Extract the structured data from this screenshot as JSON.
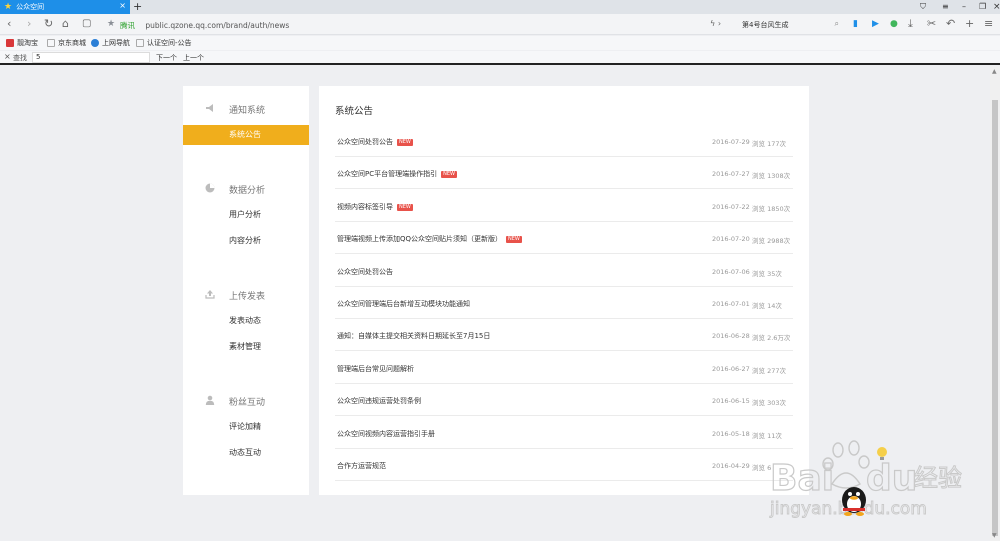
{
  "browser": {
    "tab_title": "公众空间",
    "new_tab": "+",
    "url_verified": "腾讯",
    "url": "public.qzone.qq.com/brand/auth/news",
    "search_text": "第4号台风生成",
    "bookmarks": [
      "靓淘宝",
      "京东商城",
      "上网导航",
      "认证空间-公告"
    ],
    "find_label": "查找",
    "find_value": "5",
    "find_next": "下一个",
    "find_prev": "上一个"
  },
  "colors": {
    "accent": "#f0ae1c",
    "tab_blue": "#1e8fe8",
    "new_badge": "#e8524a"
  },
  "sidebar": {
    "sections": [
      {
        "label": "通知系统",
        "icon": "megaphone-icon",
        "items": [
          {
            "label": "系统公告",
            "active": true
          }
        ]
      },
      {
        "label": "数据分析",
        "icon": "pie-chart-icon",
        "items": [
          {
            "label": "用户分析"
          },
          {
            "label": "内容分析"
          }
        ]
      },
      {
        "label": "上传发表",
        "icon": "upload-icon",
        "items": [
          {
            "label": "发表动态"
          },
          {
            "label": "素材管理"
          }
        ]
      },
      {
        "label": "粉丝互动",
        "icon": "user-icon",
        "items": [
          {
            "label": "评论加精"
          },
          {
            "label": "动态互动"
          }
        ]
      }
    ]
  },
  "main": {
    "title": "系统公告",
    "badge_label": "NEW",
    "news": [
      {
        "title": "公众空间处罚公告",
        "is_new": true,
        "date": "2016-07-29",
        "views": "浏览 177次"
      },
      {
        "title": "公众空间PC平台管理端操作指引",
        "is_new": true,
        "date": "2016-07-27",
        "views": "浏览 1308次"
      },
      {
        "title": "视频内容标签引导",
        "is_new": true,
        "date": "2016-07-22",
        "views": "浏览 1850次"
      },
      {
        "title": "管理端视频上传添加QQ公众空间贴片须知（更新版）",
        "is_new": true,
        "date": "2016-07-20",
        "views": "浏览 2988次"
      },
      {
        "title": "公众空间处罚公告",
        "is_new": false,
        "date": "2016-07-06",
        "views": "浏览 35次"
      },
      {
        "title": "公众空间管理端后台新增互动模块功能通知",
        "is_new": false,
        "date": "2016-07-01",
        "views": "浏览 14次"
      },
      {
        "title": "通知：自媒体主提交相关资料日期延长至7月15日",
        "is_new": false,
        "date": "2016-06-28",
        "views": "浏览 2.6万次"
      },
      {
        "title": "管理端后台常见问题解析",
        "is_new": false,
        "date": "2016-06-27",
        "views": "浏览 277次"
      },
      {
        "title": "公众空间违规运营处罚条例",
        "is_new": false,
        "date": "2016-06-15",
        "views": "浏览 303次"
      },
      {
        "title": "公众空间视频内容运营指引手册",
        "is_new": false,
        "date": "2016-05-18",
        "views": "浏览 11次"
      },
      {
        "title": "合作方运营规范",
        "is_new": false,
        "date": "2016-04-29",
        "views": "浏览 6"
      }
    ]
  },
  "watermark": {
    "text": "Baidu 经验",
    "url": "jingyan.baidu.com"
  }
}
